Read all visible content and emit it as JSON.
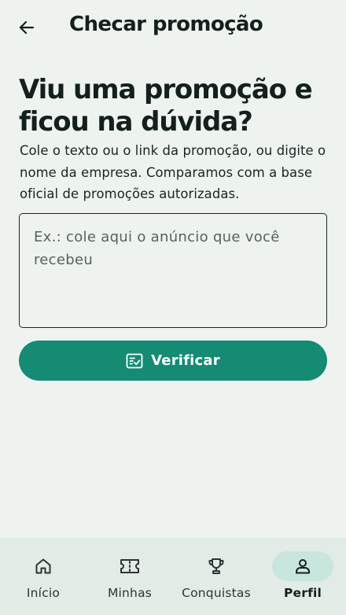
{
  "header": {
    "title": "Checar promoção",
    "back_icon": "arrow-left-icon"
  },
  "main": {
    "headline": "Viu uma promoção e ficou na dúvida?",
    "description": "Cole o texto ou o link da promoção, ou digite o nome da empresa. Comparamos com a base oficial de promoções autorizadas.",
    "input": {
      "value": "",
      "placeholder": "Ex.: cole aqui o anúncio que você recebeu"
    },
    "verify_button": {
      "label": "Verificar",
      "icon": "checklist-icon"
    }
  },
  "nav": {
    "items": [
      {
        "label": "Início",
        "icon": "home-icon",
        "active": false
      },
      {
        "label": "Minhas",
        "icon": "ticket-icon",
        "active": false
      },
      {
        "label": "Conquistas",
        "icon": "trophy-icon",
        "active": false
      },
      {
        "label": "Perfil",
        "icon": "person-icon",
        "active": true
      }
    ]
  },
  "colors": {
    "background": "#eef3f0",
    "primary": "#158b74",
    "nav_background": "#e3ebe7",
    "nav_active_pill": "#c8e6dd",
    "text": "#14201b"
  }
}
